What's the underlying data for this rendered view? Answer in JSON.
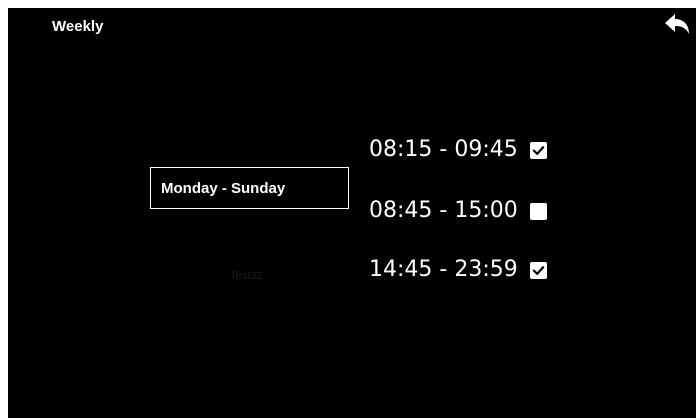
{
  "header": {
    "title": "Weekly",
    "back_icon": "reply-arrow-icon"
  },
  "schedule": {
    "day_range": "Monday - Sunday",
    "name": "Test32"
  },
  "time_slots": [
    {
      "range": "08:15 - 09:45",
      "enabled": true
    },
    {
      "range": "08:45 - 15:00",
      "enabled": false
    },
    {
      "range": "14:45 - 23:59",
      "enabled": true
    }
  ],
  "colors": {
    "background": "#000000",
    "foreground": "#ffffff",
    "muted_label": "#1c1c1c"
  }
}
